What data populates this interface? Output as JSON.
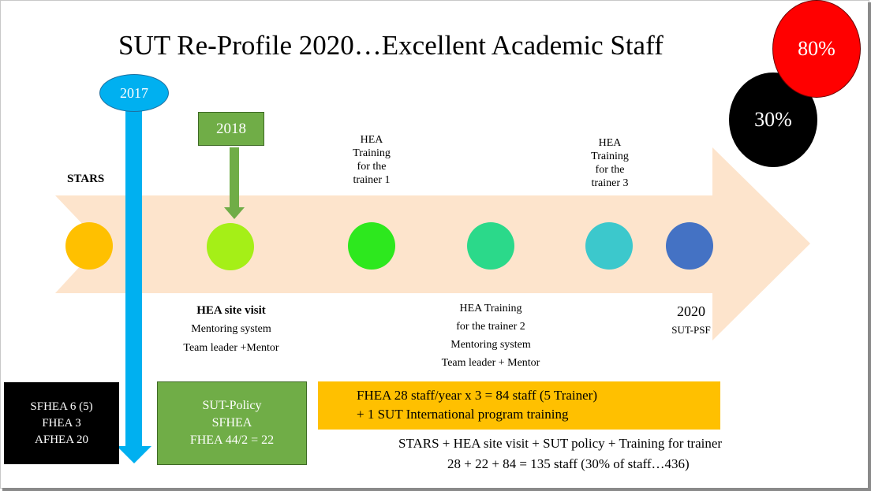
{
  "title": "SUT Re-Profile 2020…Excellent Academic Staff",
  "colors": {
    "band": "#fde4cc",
    "stars_node": "#ffc000",
    "node_2018": "#a5ef17",
    "node_trainer1": "#2de81e",
    "node_trainer2": "#2bd98a",
    "node_trainer3": "#3cc8cc",
    "node_2020": "#4472c4",
    "year_blue": "#00b0f0",
    "green_box": "#70ad47",
    "gold_box": "#ffc000",
    "red": "#ff0000",
    "black": "#000000"
  },
  "badges": {
    "pct_black": "30%",
    "pct_red": "80%"
  },
  "year_2017": "2017",
  "year_2018": "2018",
  "stars_label": "STARS",
  "trainer1": [
    "HEA",
    "Training",
    "for the",
    "trainer 1"
  ],
  "trainer3": [
    "HEA",
    "Training",
    "for the",
    "trainer 3"
  ],
  "site_visit": {
    "heading": "HEA site visit",
    "line1": "Mentoring system",
    "line2": "Team leader +Mentor"
  },
  "trainer2": {
    "line1": "HEA Training",
    "line2": "for the trainer 2",
    "line3": "Mentoring system",
    "line4": "Team leader + Mentor"
  },
  "milestone_2020": {
    "year": "2020",
    "label": "SUT-PSF"
  },
  "black_box": [
    "SFHEA 6 (5)",
    "FHEA 3",
    "AFHEA 20"
  ],
  "green_box": [
    "SUT-Policy",
    "SFHEA",
    "FHEA 44/2 = 22"
  ],
  "gold_box": [
    "FHEA 28 staff/year x 3 = 84 staff (5 Trainer)",
    "+ 1 SUT International program training"
  ],
  "summary": {
    "line1": "STARS  + HEA site visit + SUT policy + Training for trainer",
    "line2": "28 + 22 + 84 = 135 staff  (30% of staff…436)"
  }
}
